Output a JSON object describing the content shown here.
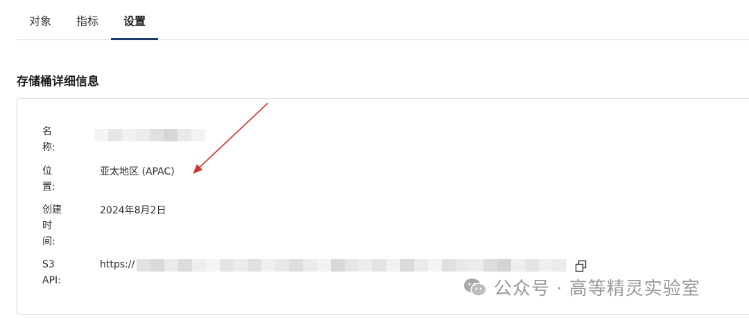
{
  "tabs": [
    {
      "label": "对象"
    },
    {
      "label": "指标"
    },
    {
      "label": "设置"
    }
  ],
  "section": {
    "title": "存储桶详细信息"
  },
  "details": {
    "name_label": "名\n称:",
    "location_label": "位\n置:",
    "location_value": "亚太地区 (APAC)",
    "created_label": "创建\n时\n间:",
    "created_value": "2024年8月2日",
    "s3api_label": "S3\nAPI:",
    "s3api_prefix": "https://"
  },
  "icons": {
    "copy": "copy-icon",
    "watermark_logo": "wechat-icon"
  },
  "watermark": {
    "text": "公众号 · 高等精灵实验室"
  },
  "colors": {
    "active_tab_underline": "#1a3d6e",
    "annotation_arrow": "#d0312d",
    "watermark": "#9a9a9a"
  }
}
